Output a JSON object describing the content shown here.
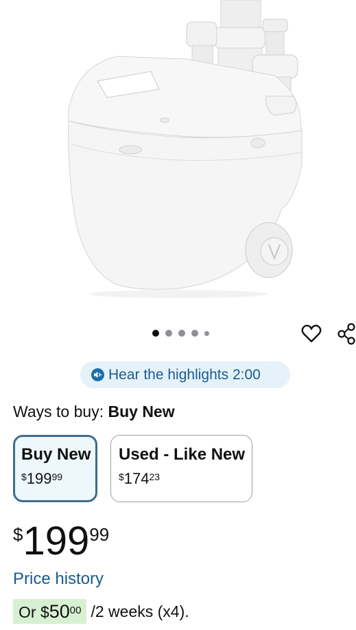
{
  "product": {
    "image_alt": "White sink pump with discharge pipes"
  },
  "carousel": {
    "dots": 5,
    "active_index": 0
  },
  "actions": {
    "favorite_icon": "heart-icon",
    "share_icon": "share-icon"
  },
  "highlights": {
    "icon": "speaker-icon",
    "label": "Hear the highlights 2:00"
  },
  "ways_to_buy": {
    "label": "Ways to buy:",
    "selected": "Buy New",
    "options": [
      {
        "title": "Buy New",
        "currency": "$",
        "whole": "199",
        "fraction": "99",
        "selected": true
      },
      {
        "title": "Used - Like New",
        "currency": "$",
        "whole": "174",
        "fraction": "23",
        "selected": false
      }
    ]
  },
  "price": {
    "currency": "$",
    "whole": "199",
    "fraction": "99"
  },
  "price_history": {
    "label": "Price history"
  },
  "installment": {
    "prefix": "Or ",
    "currency": "$",
    "whole": "50",
    "fraction": "00",
    "suffix": "/2 weeks (x4)."
  },
  "colors": {
    "link": "#1a5a92",
    "highlight_bg": "#e5f2fa",
    "selected_border": "#3d6d8c",
    "installment_bg": "#d8f0d2"
  }
}
